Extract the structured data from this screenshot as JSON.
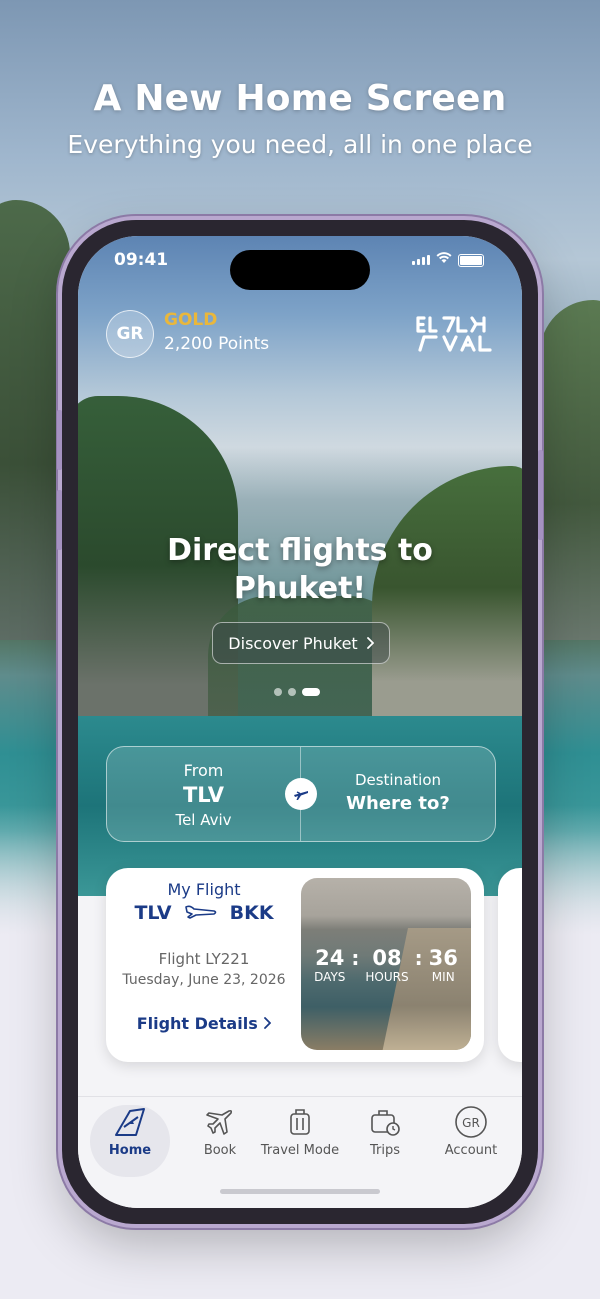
{
  "banner": {
    "title": "A New Home Screen",
    "subtitle": "Everything you need, all in one place"
  },
  "status_bar": {
    "time": "09:41"
  },
  "account": {
    "initials": "GR",
    "tier": "GOLD",
    "points": "2,200 Points"
  },
  "brand": {
    "logo_name": "elal-logo"
  },
  "promo": {
    "title_line1": "Direct flights to",
    "title_line2": "Phuket!",
    "button_label": "Discover Phuket",
    "carousel_pages": 3,
    "carousel_active_index": 2
  },
  "route": {
    "from_label": "From",
    "from_code": "TLV",
    "from_city": "Tel Aviv",
    "destination_label": "Destination",
    "destination_value": "Where to?"
  },
  "my_flight": {
    "heading": "My Flight",
    "origin": "TLV",
    "destination": "BKK",
    "flight_number": "Flight LY221",
    "date": "Tuesday, June 23, 2026",
    "details_link": "Flight Details",
    "countdown": {
      "days": "24",
      "days_label": "DAYS",
      "hours": "08",
      "hours_label": "HOURS",
      "minutes": "36",
      "minutes_label": "MIN"
    }
  },
  "tabs": [
    {
      "label": "Home",
      "icon": "tail-fin-icon",
      "active": true
    },
    {
      "label": "Book",
      "icon": "airplane-icon",
      "active": false
    },
    {
      "label": "Travel Mode",
      "icon": "luggage-icon",
      "active": false
    },
    {
      "label": "Trips",
      "icon": "suitcase-clock-icon",
      "active": false
    },
    {
      "label": "Account",
      "icon": "avatar-icon",
      "initials": "GR",
      "active": false
    }
  ],
  "colors": {
    "brand_blue": "#1b3b87",
    "gold": "#e9b73c",
    "phone_frame": "#b9a8cf"
  }
}
